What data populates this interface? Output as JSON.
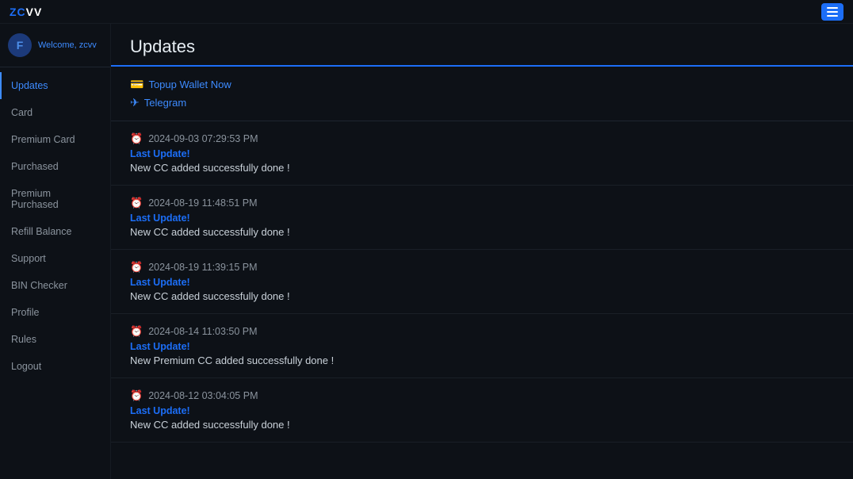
{
  "topnav": {
    "logo_prefix": "ZC",
    "logo_suffix": "VV",
    "logo_full": "ZCVV"
  },
  "sidebar": {
    "welcome_text": "Welcome,",
    "username": "zcvv",
    "avatar_icon": "F",
    "items": [
      {
        "id": "updates",
        "label": "Updates",
        "active": true
      },
      {
        "id": "card",
        "label": "Card",
        "active": false
      },
      {
        "id": "premium-card",
        "label": "Premium Card",
        "active": false
      },
      {
        "id": "purchased",
        "label": "Purchased",
        "active": false
      },
      {
        "id": "premium-purchased",
        "label": "Premium Purchased",
        "active": false
      },
      {
        "id": "refill-balance",
        "label": "Refill Balance",
        "active": false
      },
      {
        "id": "support",
        "label": "Support",
        "active": false
      },
      {
        "id": "bin-checker",
        "label": "BIN Checker",
        "active": false
      },
      {
        "id": "profile",
        "label": "Profile",
        "active": false
      },
      {
        "id": "rules",
        "label": "Rules",
        "active": false
      },
      {
        "id": "logout",
        "label": "Logout",
        "active": false
      }
    ]
  },
  "page": {
    "title": "Updates"
  },
  "links": [
    {
      "id": "topup",
      "icon": "💳",
      "label": "Topup Wallet Now"
    },
    {
      "id": "telegram",
      "icon": "✈",
      "label": "Telegram"
    }
  ],
  "updates": [
    {
      "date": "2024-09-03 07:29:53 PM",
      "label": "Last Update!",
      "message": "New CC added successfully done !"
    },
    {
      "date": "2024-08-19 11:48:51 PM",
      "label": "Last Update!",
      "message": "New CC added successfully done !"
    },
    {
      "date": "2024-08-19 11:39:15 PM",
      "label": "Last Update!",
      "message": "New CC added successfully done !"
    },
    {
      "date": "2024-08-14 11:03:50 PM",
      "label": "Last Update!",
      "message": "New Premium CC added successfully done !"
    },
    {
      "date": "2024-08-12 03:04:05 PM",
      "label": "Last Update!",
      "message": "New CC added successfully done !"
    }
  ]
}
